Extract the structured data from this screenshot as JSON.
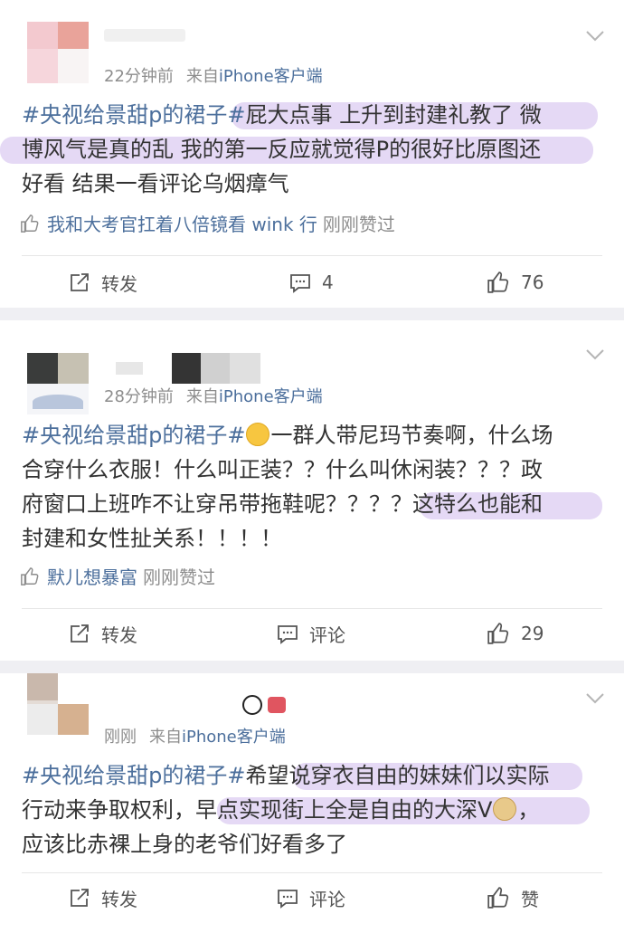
{
  "posts": [
    {
      "time": "22分钟前",
      "source_prefix": "来自",
      "source": "iPhone客户端",
      "text_lines": [
        {
          "tag": "#央视给景甜p的裙子#",
          "body": "屁大点事 上升到封建礼教了 微"
        },
        {
          "tag": "",
          "body": "博风气是真的乱 我的第一反应就觉得P的很好比原图还"
        },
        {
          "tag": "",
          "body": "好看 结果一看评论乌烟瘴气"
        }
      ],
      "liked_by": "我和大考官扛着八倍镜看 wink 行",
      "liked_suffix": "刚刚赞过",
      "repost_label": "转发",
      "comment_label": "4",
      "like_label": "76"
    },
    {
      "time": "28分钟前",
      "source_prefix": "来自",
      "source": "iPhone客户端",
      "text_lines": [
        {
          "tag": "#央视给景甜p的裙子#",
          "body": "一群人带尼玛节奏啊，什么场"
        },
        {
          "tag": "",
          "body": "合穿什么衣服！什么叫正装？？什么叫休闲装？？？政"
        },
        {
          "tag": "",
          "body": "府窗口上班咋不让穿吊带拖鞋呢？？？？这特么也能和"
        },
        {
          "tag": "",
          "body": "封建和女性扯关系！！！！"
        }
      ],
      "liked_by": "默儿想暴富",
      "liked_suffix": "刚刚赞过",
      "repost_label": "转发",
      "comment_label": "评论",
      "like_label": "29"
    },
    {
      "time": "刚刚",
      "source_prefix": "来自",
      "source": "iPhone客户端",
      "text_lines": [
        {
          "tag": "#央视给景甜p的裙子#",
          "body": "希望说穿衣自由的妹妹们以实际"
        },
        {
          "tag": "",
          "body": "行动来争取权利，早点实现街上全是自由的大深V"
        },
        {
          "tag": "",
          "body": "应该比赤裸上身的老爷们好看多了"
        }
      ],
      "line2_suffix": "，",
      "repost_label": "转发",
      "comment_label": "评论",
      "like_label": "赞"
    }
  ],
  "icons": {
    "repost": "repost-icon",
    "comment": "comment-icon",
    "like": "thumbs-up-icon",
    "more": "chevron-down-icon",
    "emoji_1": "smirk-emoji-icon",
    "emoji_2": "doge-emoji-icon",
    "badge": "panda-badge-icon"
  },
  "colors": {
    "link": "#4c6f9c",
    "meta": "#8d8d8d",
    "text": "#333333",
    "background": "#efeff3"
  }
}
